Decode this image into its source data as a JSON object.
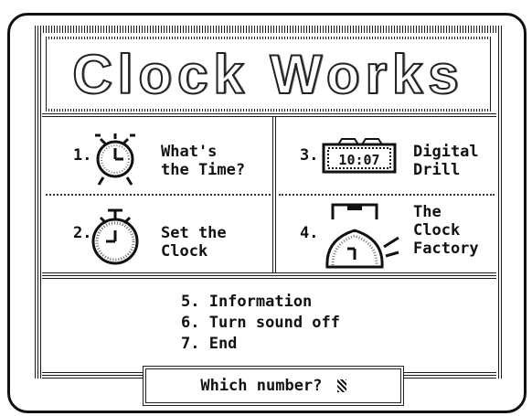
{
  "title": "Clock Works",
  "menu": {
    "item1": {
      "number": "1.",
      "label": "What's\nthe Time?"
    },
    "item2": {
      "number": "2.",
      "label": "Set the\nClock"
    },
    "item3": {
      "number": "3.",
      "label": "Digital\nDrill",
      "display": "10:07"
    },
    "item4": {
      "number": "4.",
      "label": "The\nClock\nFactory"
    }
  },
  "options": {
    "o5": "5. Information",
    "o6": "6. Turn sound off",
    "o7": "7. End"
  },
  "prompt": "Which number? "
}
